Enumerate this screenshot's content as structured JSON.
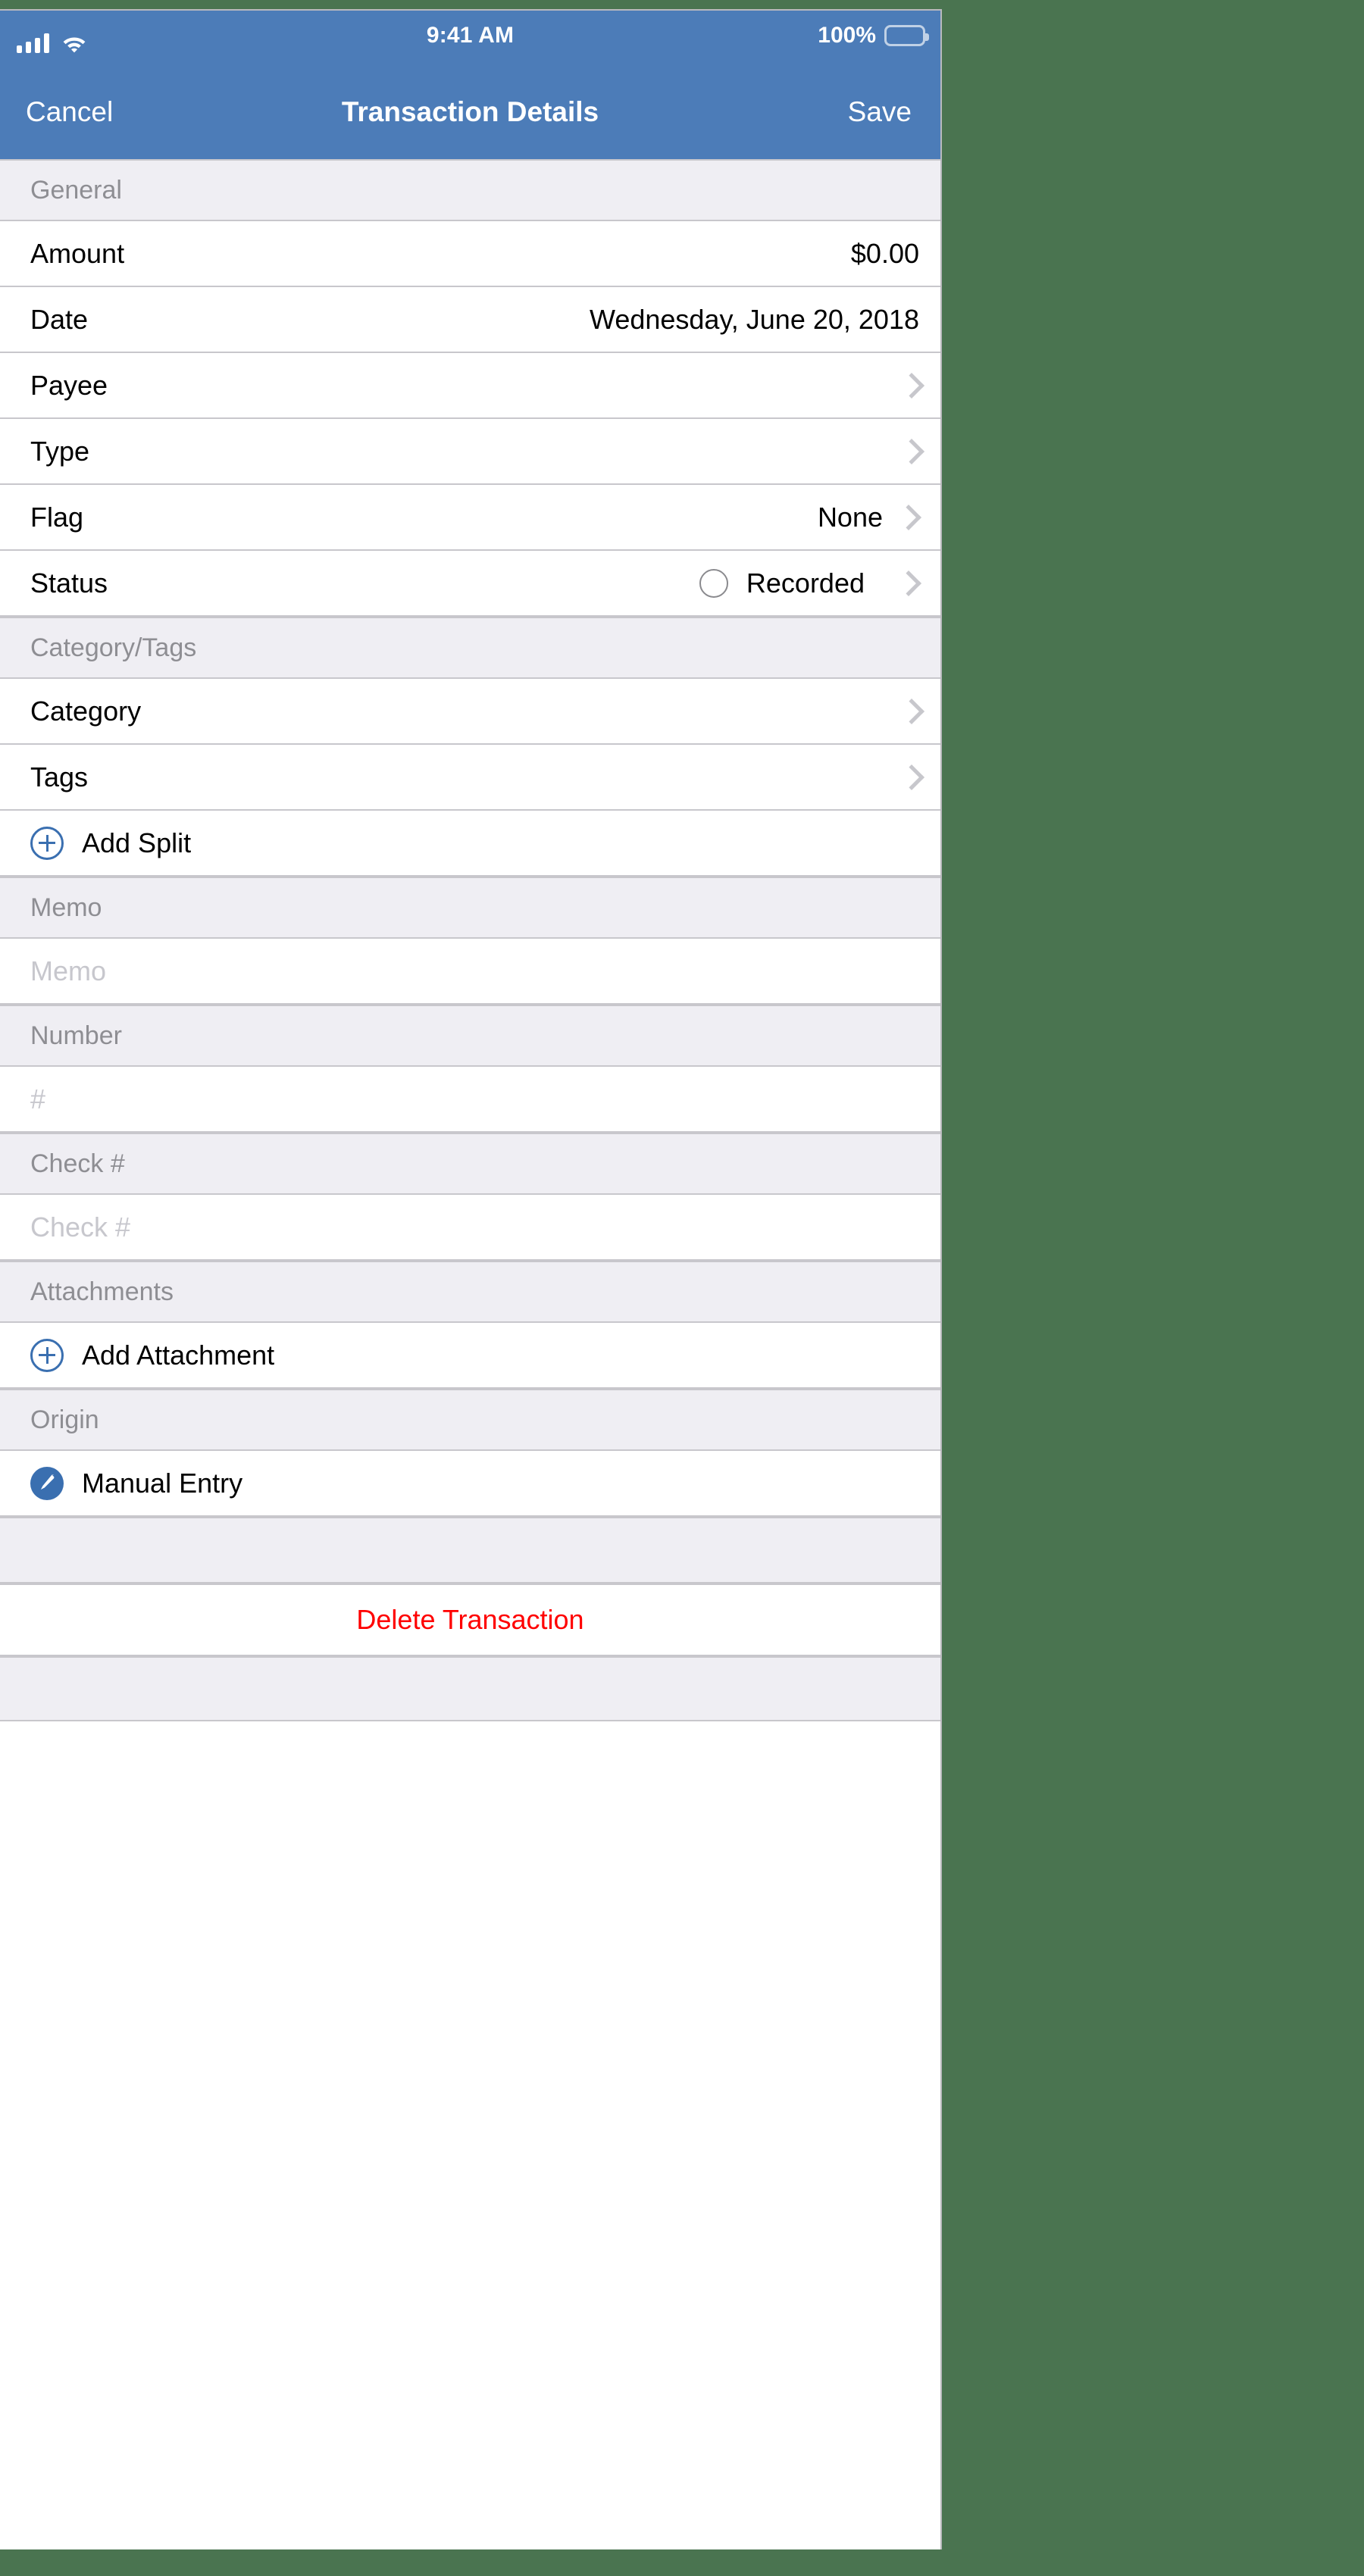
{
  "theme": {
    "background": "#4a7450",
    "navbar_blue": "#4c7cb8",
    "section_header_bg": "#efeef3",
    "separator": "#c8c7cc",
    "accent_blue": "#3a6fb0",
    "destructive_red": "#ff0000",
    "placeholder_gray": "#c7c7cd",
    "header_text_gray": "#8e8e93"
  },
  "status_bar": {
    "signal_icon": "cellular-signal-icon",
    "wifi_icon": "wifi-icon",
    "time": "9:41 AM",
    "battery_percent": "100%",
    "battery_icon": "battery-full-icon"
  },
  "navbar": {
    "cancel_label": "Cancel",
    "title": "Transaction Details",
    "save_label": "Save"
  },
  "sections": [
    {
      "key": "general",
      "header": "General",
      "rows": [
        {
          "label": "Amount",
          "value": "$0.00",
          "chevron": false
        },
        {
          "label": "Date",
          "value": "Wednesday, June 20, 2018",
          "chevron": false
        },
        {
          "label": "Payee",
          "value": "",
          "chevron": true,
          "chevron_edge": true
        },
        {
          "label": "Type",
          "value": "",
          "chevron": true,
          "chevron_edge": true
        },
        {
          "label": "Flag",
          "value": "None",
          "chevron": true
        },
        {
          "label": "Status",
          "value": "Recorded",
          "chevron": true,
          "ring": true
        }
      ]
    },
    {
      "key": "category_tags",
      "header": "Category/Tags",
      "rows": [
        {
          "label": "Category",
          "value": "",
          "chevron": true,
          "chevron_edge": true
        },
        {
          "label": "Tags",
          "value": "",
          "chevron": true,
          "chevron_edge": true
        },
        {
          "label": "Add Split",
          "value": "",
          "chevron": false,
          "icon": "plus-circle-icon"
        }
      ]
    },
    {
      "key": "memo",
      "header": "Memo",
      "rows": [
        {
          "label": "",
          "placeholder": "Memo",
          "input": true
        }
      ]
    },
    {
      "key": "number",
      "header": "Number",
      "rows": [
        {
          "label": "",
          "placeholder": "#",
          "input": true
        }
      ]
    },
    {
      "key": "check_number",
      "header": "Check #",
      "rows": [
        {
          "label": "",
          "placeholder": "Check #",
          "input": true
        }
      ]
    },
    {
      "key": "attachments",
      "header": "Attachments",
      "rows": [
        {
          "label": "Add Attachment",
          "value": "",
          "chevron": false,
          "icon": "plus-circle-icon"
        }
      ]
    },
    {
      "key": "origin",
      "header": "Origin",
      "rows": [
        {
          "label": "Manual Entry",
          "value": "",
          "chevron": false,
          "icon": "pencil-circle-icon"
        }
      ]
    }
  ],
  "footer": {
    "delete_label": "Delete Transaction"
  }
}
